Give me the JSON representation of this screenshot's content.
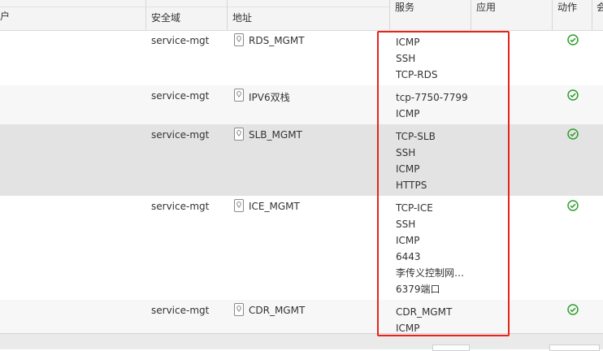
{
  "table": {
    "headers": {
      "user_partial": "户",
      "security_zone": "安全域",
      "address": "地址",
      "service": "服务",
      "application": "应用",
      "action": "动作",
      "next_partial": "会"
    },
    "rows": [
      {
        "zone": "service-mgt",
        "address": "RDS_MGMT",
        "services": [
          "ICMP",
          "SSH",
          "TCP-RDS"
        ]
      },
      {
        "zone": "service-mgt",
        "address": "IPV6双栈",
        "services": [
          "tcp-7750-7799",
          "ICMP"
        ]
      },
      {
        "zone": "service-mgt",
        "address": "SLB_MGMT",
        "services": [
          "TCP-SLB",
          "SSH",
          "ICMP",
          "HTTPS"
        ]
      },
      {
        "zone": "service-mgt",
        "address": "ICE_MGMT",
        "services": [
          "TCP-ICE",
          "SSH",
          "ICMP",
          "6443",
          "李传义控制网…",
          "6379端口"
        ]
      },
      {
        "zone": "service-mgt",
        "address": "CDR_MGMT",
        "services": [
          "CDR_MGMT",
          "ICMP"
        ]
      }
    ]
  },
  "colors": {
    "highlight_border": "#e8231b",
    "check_green": "#2e9e2e",
    "selected_row": "#e3e3e3",
    "alt_row": "#f7f7f7"
  },
  "icons": {
    "address": "address-object-icon",
    "action": "allow-check-icon"
  }
}
